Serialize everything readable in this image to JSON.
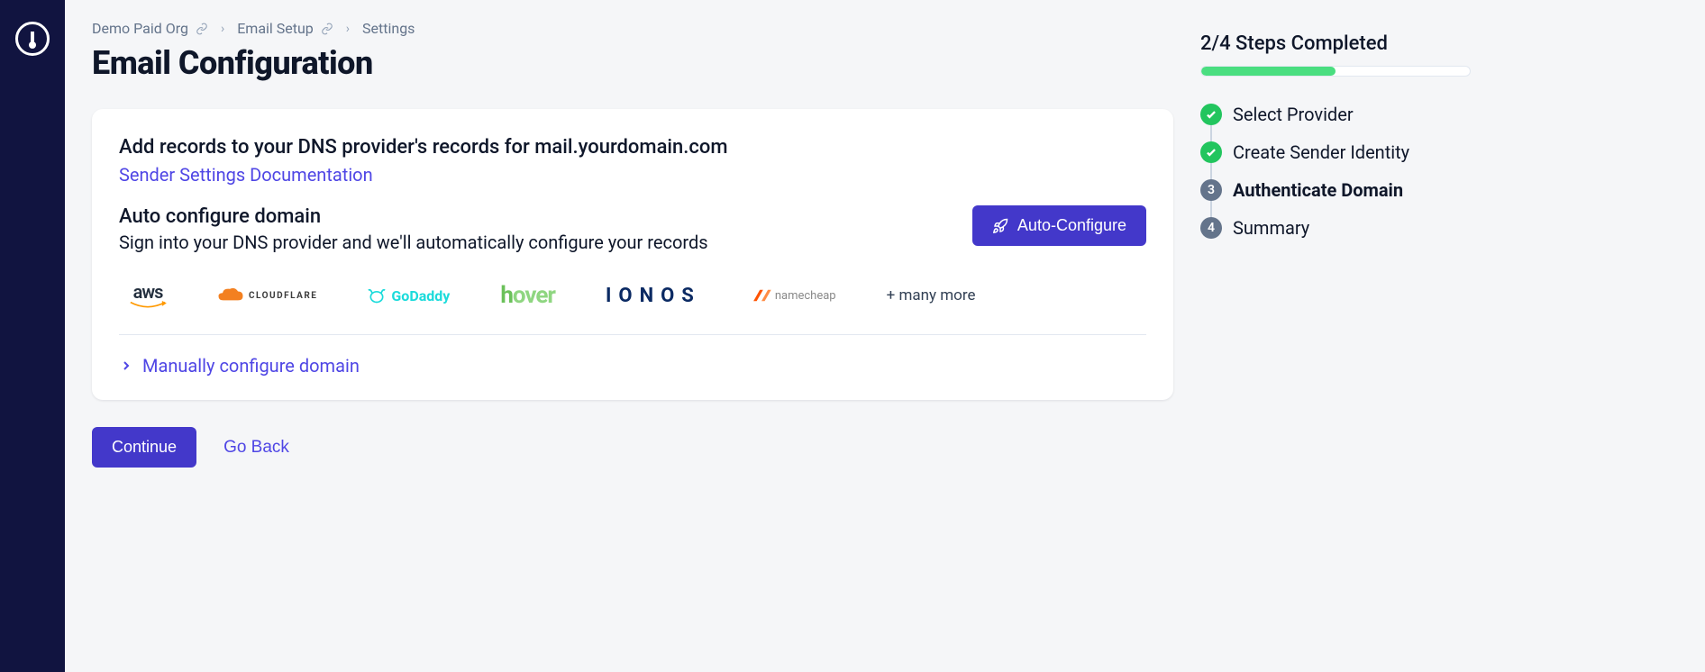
{
  "breadcrumb": {
    "org": "Demo Paid Org",
    "section": "Email Setup",
    "page": "Settings"
  },
  "page_title": "Email Configuration",
  "card": {
    "heading": "Add records to your DNS provider's records for mail.yourdomain.com",
    "doc_link": "Sender Settings Documentation",
    "auto_title": "Auto configure domain",
    "auto_sub": "Sign into your DNS provider and we'll automatically configure your records",
    "auto_button": "Auto-Configure",
    "providers": {
      "aws": "aws",
      "cloudflare": "CLOUDFLARE",
      "godaddy": "GoDaddy",
      "hover": "hover",
      "ionos": "IONOS",
      "namecheap": "namecheap",
      "more": "+ many more"
    },
    "manual_link": "Manually configure domain"
  },
  "footer": {
    "continue": "Continue",
    "go_back": "Go Back"
  },
  "steps": {
    "title": "2/4 Steps Completed",
    "progress_pct": 50,
    "items": [
      {
        "label": "Select Provider",
        "state": "done"
      },
      {
        "label": "Create Sender Identity",
        "state": "done"
      },
      {
        "label": "Authenticate Domain",
        "state": "current",
        "num": "3"
      },
      {
        "label": "Summary",
        "state": "pending",
        "num": "4"
      }
    ]
  }
}
